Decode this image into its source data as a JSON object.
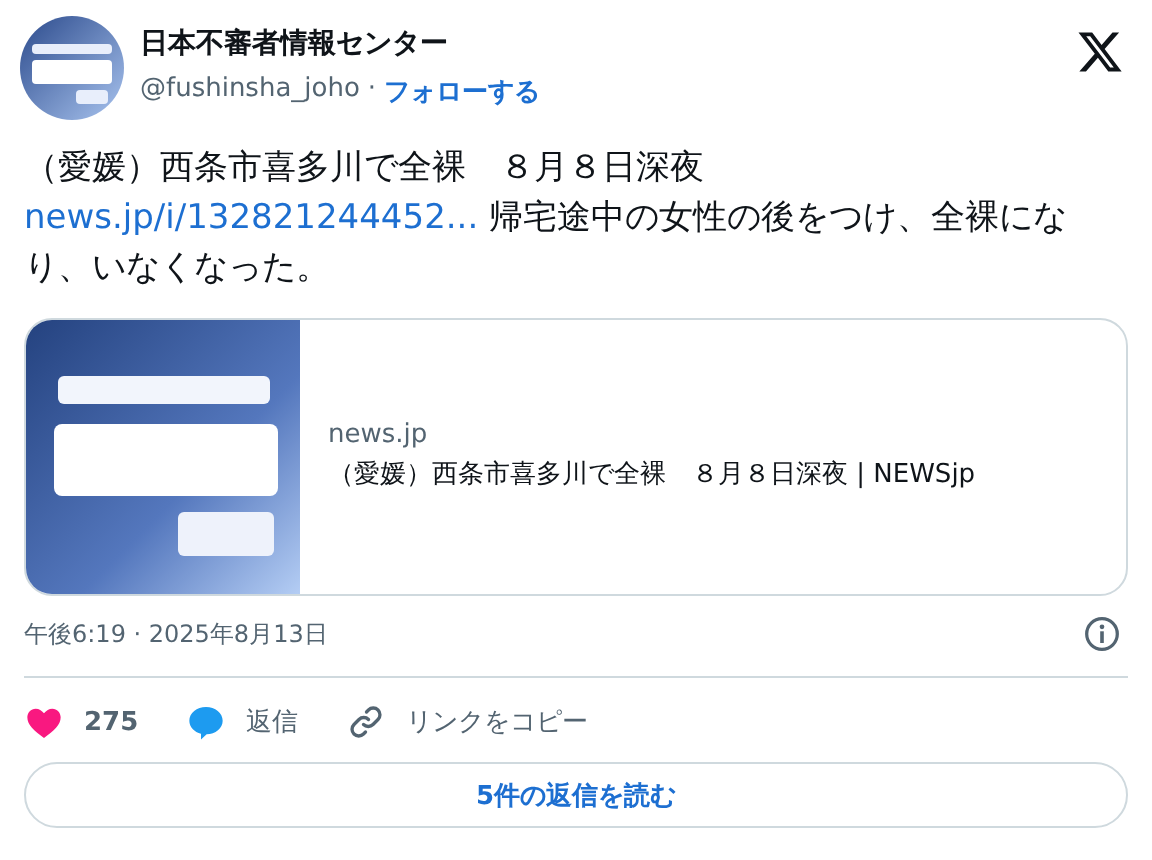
{
  "author": {
    "name": "日本不審者情報センター",
    "handle": "@fushinsha_joho",
    "separator": "·",
    "follow": "フォローする"
  },
  "tweet": {
    "text_before": "（愛媛）西条市喜多川で全裸　８月８日深夜 ",
    "link": "news.jp/i/132821244452...",
    "text_after": " 帰宅途中の女性の後をつけ、全裸になり、いなくなった。"
  },
  "card": {
    "domain": "news.jp",
    "title": "（愛媛）西条市喜多川で全裸　８月８日深夜 | NEWSjp"
  },
  "timestamp": "午後6:19 · 2025年8月13日",
  "actions": [
    {
      "kind": "like",
      "label": "275"
    },
    {
      "kind": "reply",
      "label": "返信"
    },
    {
      "kind": "copy",
      "label": "リンクをコピー"
    }
  ],
  "read_replies": "5件の返信を読む"
}
